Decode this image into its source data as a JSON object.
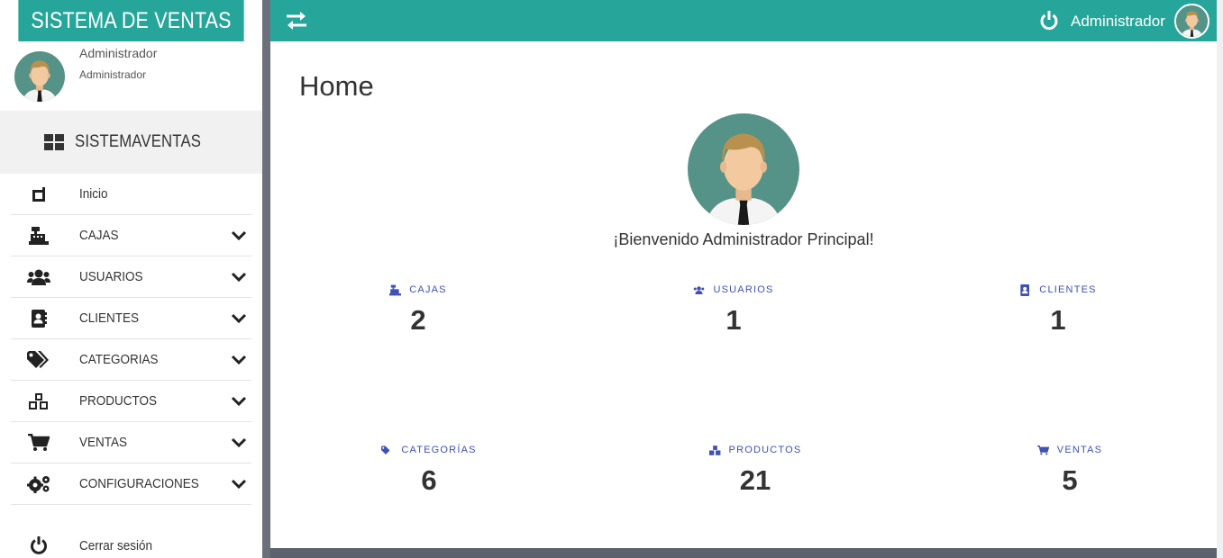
{
  "brand": {
    "title": "SISTEMA DE VENTAS"
  },
  "user": {
    "name": "Administrador",
    "role": "Administrador"
  },
  "system": {
    "label": "SISTEMAVENTAS"
  },
  "nav": [
    {
      "label": "Inicio",
      "icon": "home-icon",
      "expandable": false
    },
    {
      "label": "CAJAS",
      "icon": "cash-register-icon",
      "expandable": true
    },
    {
      "label": "USUARIOS",
      "icon": "users-icon",
      "expandable": true
    },
    {
      "label": "CLIENTES",
      "icon": "address-book-icon",
      "expandable": true
    },
    {
      "label": "CATEGORIAS",
      "icon": "tags-icon",
      "expandable": true
    },
    {
      "label": "PRODUCTOS",
      "icon": "cubes-icon",
      "expandable": true
    },
    {
      "label": "VENTAS",
      "icon": "shopping-cart-icon",
      "expandable": true
    },
    {
      "label": "CONFIGURACIONES",
      "icon": "cogs-icon",
      "expandable": true
    }
  ],
  "logout": {
    "label": "Cerrar sesión"
  },
  "topbar": {
    "user_name": "Administrador"
  },
  "main": {
    "title": "Home",
    "welcome": "¡Bienvenido Administrador Principal!",
    "stats": [
      {
        "label": "CAJAS",
        "value": "2",
        "icon": "cash-register-icon"
      },
      {
        "label": "USUARIOS",
        "value": "1",
        "icon": "users-icon"
      },
      {
        "label": "CLIENTES",
        "value": "1",
        "icon": "address-book-icon"
      },
      {
        "label": "CATEGORÍAS",
        "value": "6",
        "icon": "tags-icon"
      },
      {
        "label": "PRODUCTOS",
        "value": "21",
        "icon": "cubes-icon"
      },
      {
        "label": "VENTAS",
        "value": "5",
        "icon": "shopping-cart-icon"
      }
    ]
  },
  "colors": {
    "primary": "#26a69a",
    "stat_label": "#3f51b5",
    "sidebar_bg": "#ffffff",
    "divider": "#6c707a"
  }
}
